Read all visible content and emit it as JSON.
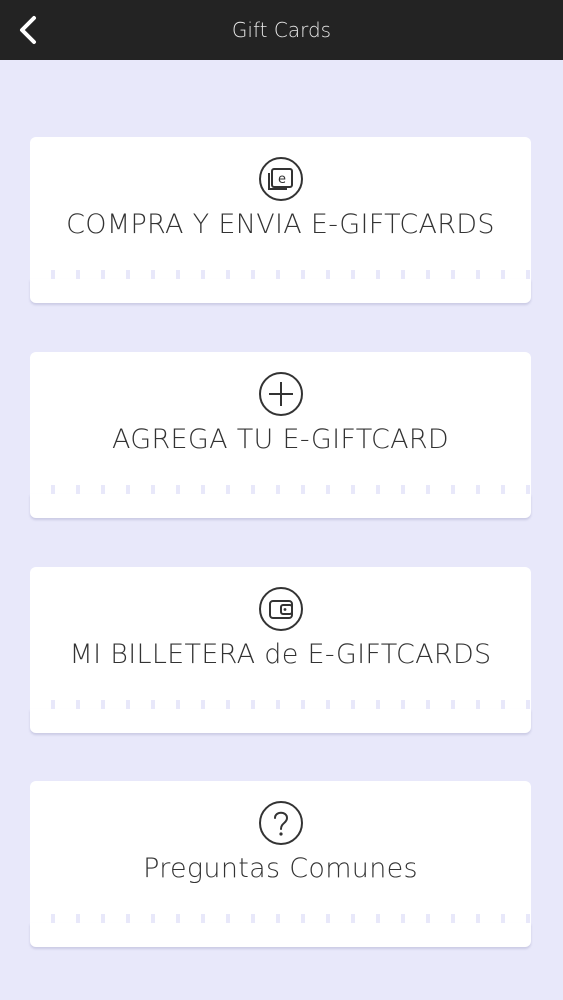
{
  "header": {
    "title": "Gift Cards",
    "back_icon": "chevron-left-icon"
  },
  "cards": [
    {
      "label": "COMPRA Y ENVIA E-GIFTCARDS",
      "icon": "e-card-icon"
    },
    {
      "label": "AGREGA TU E-GIFTCARD",
      "icon": "plus-circle-icon"
    },
    {
      "label": "MI BILLETERA de E-GIFTCARDS",
      "icon": "wallet-icon"
    },
    {
      "label": "Preguntas Comunes",
      "icon": "question-icon"
    }
  ],
  "colors": {
    "background": "#e8e8fa",
    "header": "#232323",
    "card": "#ffffff",
    "text": "#333333"
  }
}
